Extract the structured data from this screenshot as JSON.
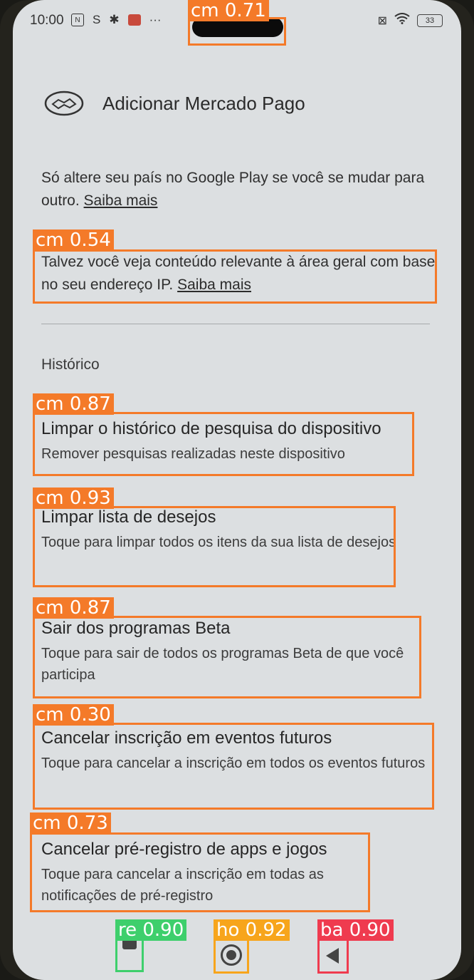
{
  "status_bar": {
    "time": "10:00",
    "battery": "33"
  },
  "header": {
    "title": "Adicionar Mercado Pago"
  },
  "country_notice": {
    "text": "Só altere seu país no Google Play se você se mudar para outro.",
    "link": "Saiba mais"
  },
  "ip_notice": {
    "text": "Talvez você veja conteúdo relevante à área geral com base no seu endereço IP.",
    "link": "Saiba mais"
  },
  "history": {
    "section_title": "Histórico",
    "items": [
      {
        "title": "Limpar o histórico de pesquisa do dispositivo",
        "subtitle": "Remover pesquisas realizadas neste dispositivo"
      },
      {
        "title": "Limpar lista de desejos",
        "subtitle": "Toque para limpar todos os itens da sua lista de desejos"
      },
      {
        "title": "Sair dos programas Beta",
        "subtitle": "Toque para sair de todos os programas Beta de que você participa"
      },
      {
        "title": "Cancelar inscrição em eventos futuros",
        "subtitle": "Toque para cancelar a inscrição em todos os eventos futuros"
      },
      {
        "title": "Cancelar pré-registro de apps e jogos",
        "subtitle": "Toque para cancelar a inscrição em todas as notificações de pré-registro"
      }
    ]
  },
  "detections": [
    {
      "label": "cm 0.71"
    },
    {
      "label": "cm 0.54"
    },
    {
      "label": "cm 0.87"
    },
    {
      "label": "cm 0.93"
    },
    {
      "label": "cm 0.87"
    },
    {
      "label": "cm 0.30"
    },
    {
      "label": "cm 0.73"
    },
    {
      "label": "re 0.90"
    },
    {
      "label": "ho 0.92"
    },
    {
      "label": "ba 0.90"
    }
  ],
  "colors": {
    "box_orange": "#f47a29",
    "box_green": "#3ecf6c",
    "box_yellow": "#f7a51c",
    "box_red": "#ef3b4f"
  }
}
